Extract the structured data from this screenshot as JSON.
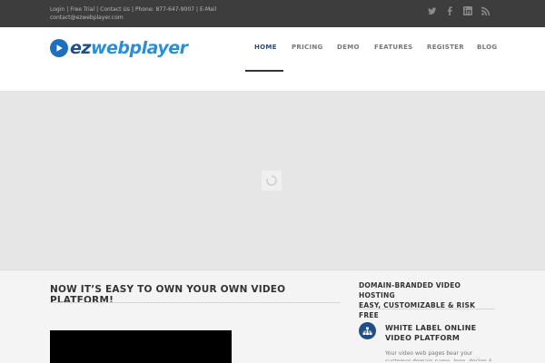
{
  "topbar": {
    "links": [
      "Login",
      "Free Trial",
      "Contact Us"
    ],
    "phone": "Phone: 877-647-9007",
    "email": "E-Mail contact@ezwebplayer.com",
    "social_icons": [
      "twitter-icon",
      "facebook-icon",
      "linkedin-icon",
      "rss-icon"
    ]
  },
  "header": {
    "logo_text_a": "ez",
    "logo_text_b": "webplayer",
    "nav": [
      "HOME",
      "PRICING",
      "DEMO",
      "FEATURES",
      "REGISTER",
      "BLOG"
    ],
    "active_nav": "HOME"
  },
  "colors": {
    "brand_blue": "#1f4e8a",
    "accent_blue": "#2b8fd6",
    "topbar_bg": "#3d3d3d"
  },
  "main": {
    "title": "NOW IT’S EASY TO OWN YOUR OWN VIDEO PLATFORM!"
  },
  "sidebar": {
    "title_line1": "DOMAIN-BRANDED VIDEO HOSTING",
    "title_line2": "EASY, CUSTOMIZABLE & RISK FREE",
    "feature_heading_line1": "WHITE LABEL ONLINE",
    "feature_heading_line2": "VIDEO PLATFORM",
    "feature_text": "Your video web pages bear your customer domain name, logo, design &"
  }
}
